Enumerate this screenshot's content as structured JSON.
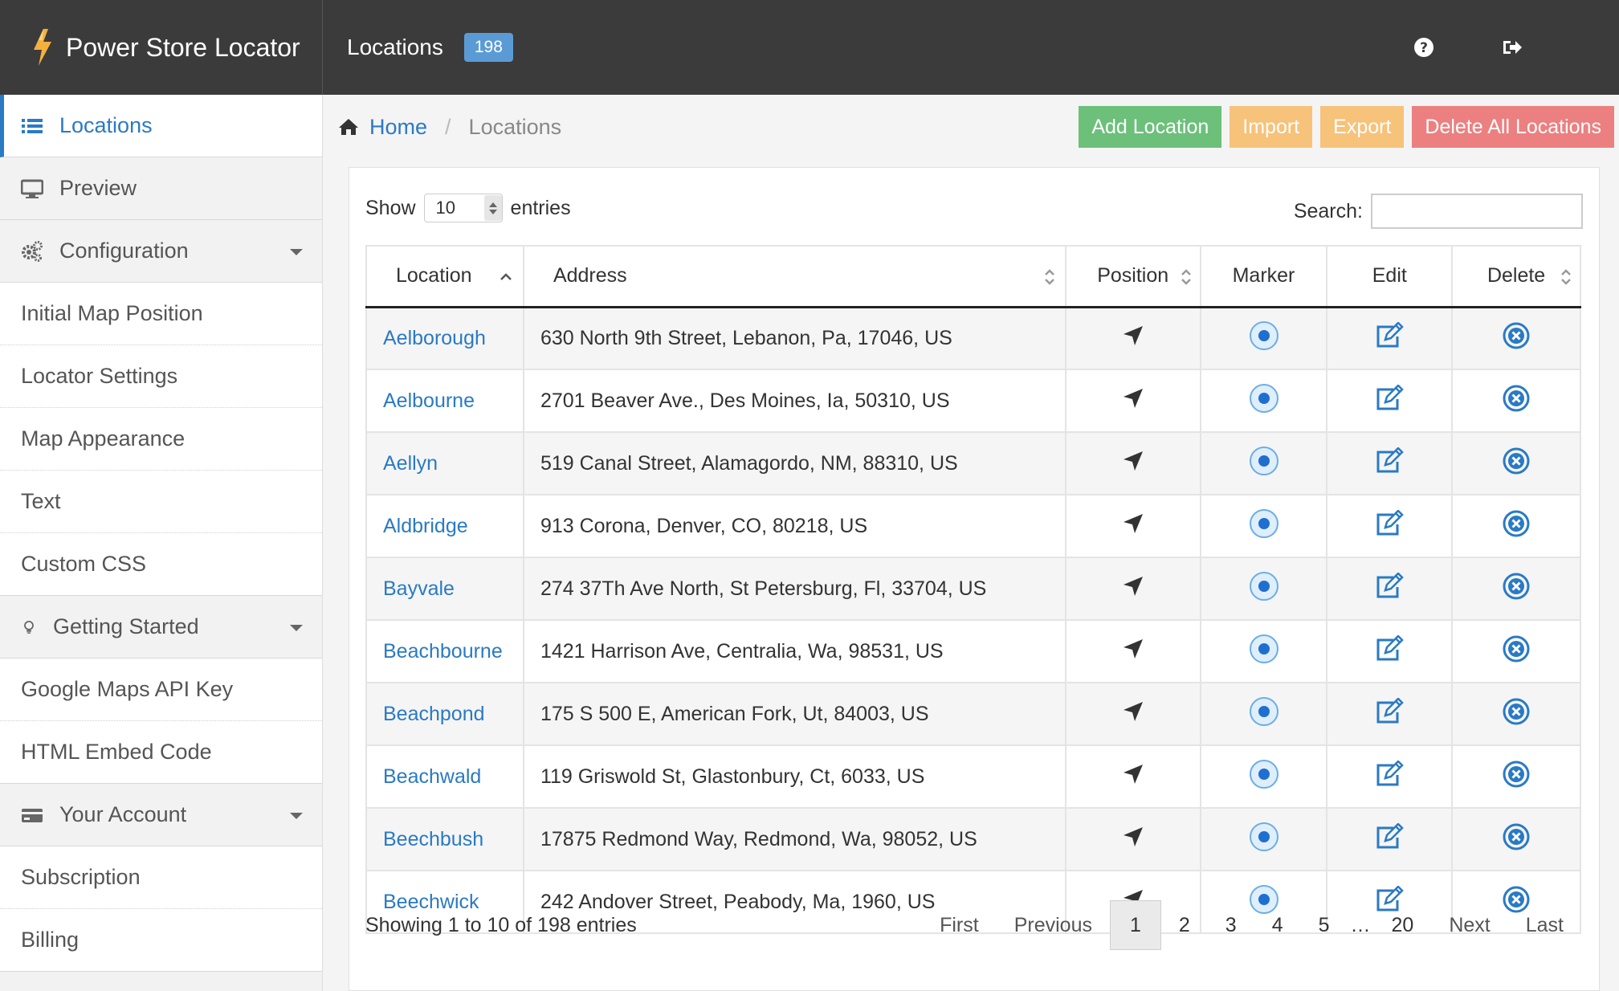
{
  "app": {
    "brand": "Power Store Locator",
    "page_title": "Locations",
    "count_badge": "198"
  },
  "colors": {
    "accent": "#2a7ac4",
    "add": "#6cc07a",
    "import_export": "#f7c27a",
    "delete_all": "#ec8080",
    "topbar": "#3b3b3b"
  },
  "top_icons": [
    "help-icon",
    "logout-icon"
  ],
  "sidebar": {
    "items": [
      {
        "label": "Locations",
        "type": "section",
        "icon": "list-icon",
        "active": true
      },
      {
        "label": "Preview",
        "type": "section",
        "icon": "monitor-icon"
      },
      {
        "label": "Configuration",
        "type": "section",
        "icon": "gears-icon",
        "caret": true
      },
      {
        "label": "Initial Map Position",
        "type": "sub"
      },
      {
        "label": "Locator Settings",
        "type": "sub"
      },
      {
        "label": "Map Appearance",
        "type": "sub"
      },
      {
        "label": "Text",
        "type": "sub"
      },
      {
        "label": "Custom CSS",
        "type": "sub"
      },
      {
        "label": "Getting Started",
        "type": "section",
        "icon": "lightbulb-icon",
        "caret": true
      },
      {
        "label": "Google Maps API Key",
        "type": "sub"
      },
      {
        "label": "HTML Embed Code",
        "type": "sub"
      },
      {
        "label": "Your Account",
        "type": "section",
        "icon": "credit-card-icon",
        "caret": true
      },
      {
        "label": "Subscription",
        "type": "sub"
      },
      {
        "label": "Billing",
        "type": "sub"
      }
    ]
  },
  "breadcrumb": {
    "home": "Home",
    "separator": "/",
    "current": "Locations"
  },
  "actions": {
    "add": "Add Location",
    "import": "Import",
    "export": "Export",
    "delete_all": "Delete All Locations"
  },
  "table_controls": {
    "show_label": "Show",
    "page_length": "10",
    "entries_label": "entries",
    "search_label": "Search:",
    "search_value": ""
  },
  "columns": [
    "Location",
    "Address",
    "Position",
    "Marker",
    "Edit",
    "Delete"
  ],
  "rows": [
    {
      "location": "Aelborough",
      "address": "630 North 9th Street, Lebanon, Pa, 17046, US"
    },
    {
      "location": "Aelbourne",
      "address": "2701 Beaver Ave., Des Moines, Ia, 50310, US"
    },
    {
      "location": "Aellyn",
      "address": "519 Canal Street, Alamagordo, NM, 88310, US"
    },
    {
      "location": "Aldbridge",
      "address": "913 Corona, Denver, CO, 80218, US"
    },
    {
      "location": "Bayvale",
      "address": "274 37Th Ave North, St Petersburg, Fl, 33704, US"
    },
    {
      "location": "Beachbourne",
      "address": "1421 Harrison Ave, Centralia, Wa, 98531, US"
    },
    {
      "location": "Beachpond",
      "address": "175 S 500 E, American Fork, Ut, 84003, US"
    },
    {
      "location": "Beachwald",
      "address": "119 Griswold St, Glastonbury, Ct, 6033, US"
    },
    {
      "location": "Beechbush",
      "address": "17875 Redmond Way, Redmond, Wa, 98052, US"
    },
    {
      "location": "Beechwick",
      "address": "242 Andover Street, Peabody, Ma, 1960, US"
    }
  ],
  "footer": {
    "info": "Showing 1 to 10 of 198 entries",
    "first": "First",
    "previous": "Previous",
    "pages": [
      "1",
      "2",
      "3",
      "4",
      "5"
    ],
    "ellipsis": "…",
    "last_page": "20",
    "next": "Next",
    "last": "Last",
    "current_page": "1"
  }
}
